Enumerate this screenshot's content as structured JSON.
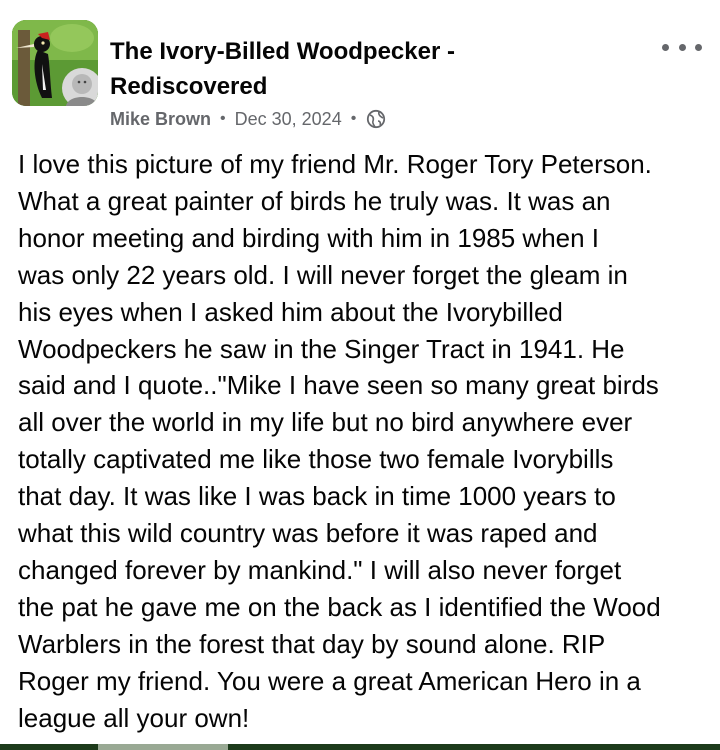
{
  "post": {
    "group_name": "The Ivory-Billed Woodpecker - Rediscovered",
    "author": "Mike Brown",
    "separator": "•",
    "date": "Dec 30, 2024",
    "audience_icon": "globe-icon",
    "more_icon": "more-options-icon",
    "avatar_icon": "group-avatar-woodpecker",
    "body": "I love this picture of my friend Mr. Roger Tory Peterson.\nWhat a great painter of birds he truly was. It was an\nhonor meeting and birding with him in 1985 when I\nwas only 22 years old. I will never forget the gleam in\nhis eyes when I asked him about the Ivorybilled\nWoodpeckers he saw in the Singer Tract in 1941. He\nsaid and I quote..\"Mike I have seen so many great birds\nall over the world in my life but no bird anywhere ever\ntotally captivated me like those two female Ivorybills\nthat day. It was like I was back in time 1000 years to\nwhat this wild country was before it was raped and\nchanged forever by mankind.\" I will also never forget\nthe pat he gave me on the back as I identified the Wood\nWarblers in the forest that day by sound alone. RIP\nRoger my friend. You were a great American Hero in a\nleague all your own!"
  },
  "colors": {
    "text_primary": "#050505",
    "text_secondary": "#65676b",
    "background": "#ffffff",
    "avatar_green": "#4f8a2c"
  }
}
